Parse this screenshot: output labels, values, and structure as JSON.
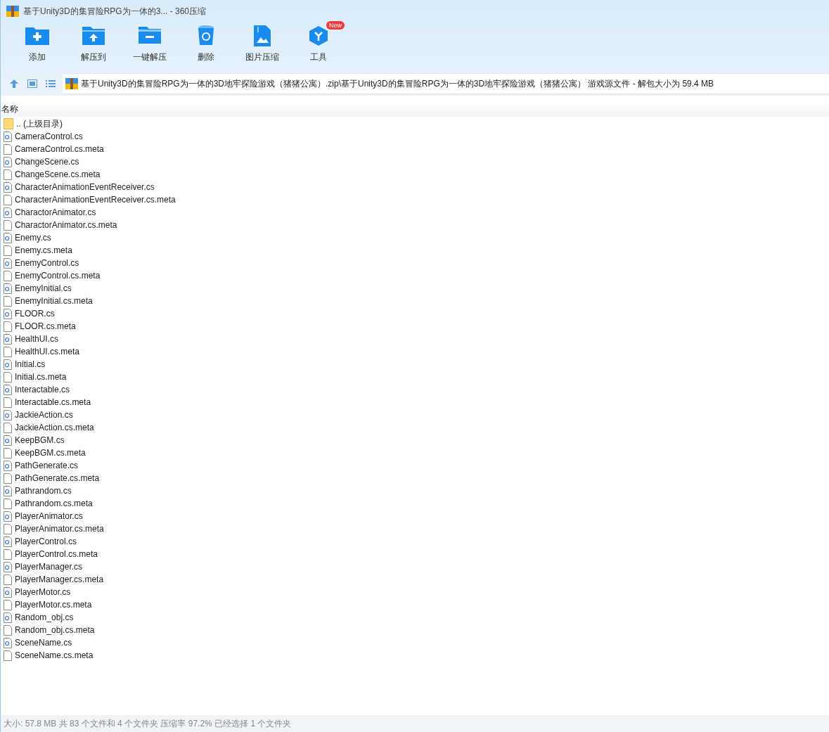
{
  "window": {
    "title": "基于Unity3D的集冒险RPG为一体的3... - 360压缩"
  },
  "toolbar": [
    {
      "kind": "add",
      "label": "添加"
    },
    {
      "kind": "extract",
      "label": "解压到"
    },
    {
      "kind": "oneclick",
      "label": "一键解压"
    },
    {
      "kind": "delete",
      "label": "删除"
    },
    {
      "kind": "image",
      "label": "图片压缩"
    },
    {
      "kind": "tools",
      "label": "工具",
      "badge": "New"
    }
  ],
  "address_bar": {
    "path": "基于Unity3D的集冒险RPG为一体的3D地牢探险游戏（猪猪公寓）.zip\\基于Unity3D的集冒险RPG为一体的3D地牢探险游戏（猪猪公寓） 游戏源文件 - 解包大小为 59.4 MB"
  },
  "table": {
    "columns": [
      "名称"
    ],
    "rows": [
      {
        "kind": "parent",
        "name": ".. (上级目录)"
      },
      {
        "kind": "cs",
        "name": "CameraControl.cs"
      },
      {
        "kind": "meta",
        "name": "CameraControl.cs.meta"
      },
      {
        "kind": "cs",
        "name": "ChangeScene.cs"
      },
      {
        "kind": "meta",
        "name": "ChangeScene.cs.meta"
      },
      {
        "kind": "cs",
        "name": "CharacterAnimationEventReceiver.cs"
      },
      {
        "kind": "meta",
        "name": "CharacterAnimationEventReceiver.cs.meta"
      },
      {
        "kind": "cs",
        "name": "CharactorAnimator.cs"
      },
      {
        "kind": "meta",
        "name": "CharactorAnimator.cs.meta"
      },
      {
        "kind": "cs",
        "name": "Enemy.cs"
      },
      {
        "kind": "meta",
        "name": "Enemy.cs.meta"
      },
      {
        "kind": "cs",
        "name": "EnemyControl.cs"
      },
      {
        "kind": "meta",
        "name": "EnemyControl.cs.meta"
      },
      {
        "kind": "cs",
        "name": "EnemyInitial.cs"
      },
      {
        "kind": "meta",
        "name": "EnemyInitial.cs.meta"
      },
      {
        "kind": "cs",
        "name": "FLOOR.cs"
      },
      {
        "kind": "meta",
        "name": "FLOOR.cs.meta"
      },
      {
        "kind": "cs",
        "name": "HealthUI.cs"
      },
      {
        "kind": "meta",
        "name": "HealthUI.cs.meta"
      },
      {
        "kind": "cs",
        "name": "Initial.cs"
      },
      {
        "kind": "meta",
        "name": "Initial.cs.meta"
      },
      {
        "kind": "cs",
        "name": "Interactable.cs"
      },
      {
        "kind": "meta",
        "name": "Interactable.cs.meta"
      },
      {
        "kind": "cs",
        "name": "JackieAction.cs"
      },
      {
        "kind": "meta",
        "name": "JackieAction.cs.meta"
      },
      {
        "kind": "cs",
        "name": "KeepBGM.cs"
      },
      {
        "kind": "meta",
        "name": "KeepBGM.cs.meta"
      },
      {
        "kind": "cs",
        "name": "PathGenerate.cs"
      },
      {
        "kind": "meta",
        "name": "PathGenerate.cs.meta"
      },
      {
        "kind": "cs",
        "name": "Pathrandom.cs"
      },
      {
        "kind": "meta",
        "name": "Pathrandom.cs.meta"
      },
      {
        "kind": "cs",
        "name": "PlayerAnimator.cs"
      },
      {
        "kind": "meta",
        "name": "PlayerAnimator.cs.meta"
      },
      {
        "kind": "cs",
        "name": "PlayerControl.cs"
      },
      {
        "kind": "meta",
        "name": "PlayerControl.cs.meta"
      },
      {
        "kind": "cs",
        "name": "PlayerManager.cs"
      },
      {
        "kind": "meta",
        "name": "PlayerManager.cs.meta"
      },
      {
        "kind": "cs",
        "name": "PlayerMotor.cs"
      },
      {
        "kind": "meta",
        "name": "PlayerMotor.cs.meta"
      },
      {
        "kind": "cs",
        "name": "Random_obj.cs"
      },
      {
        "kind": "meta",
        "name": "Random_obj.cs.meta"
      },
      {
        "kind": "cs",
        "name": "SceneName.cs"
      },
      {
        "kind": "meta",
        "name": "SceneName.cs.meta"
      }
    ]
  },
  "status_bar": "大小: 57.8 MB 共 83 个文件和 4 个文件夹 压缩率 97.2% 已经选择 1 个文件夹"
}
